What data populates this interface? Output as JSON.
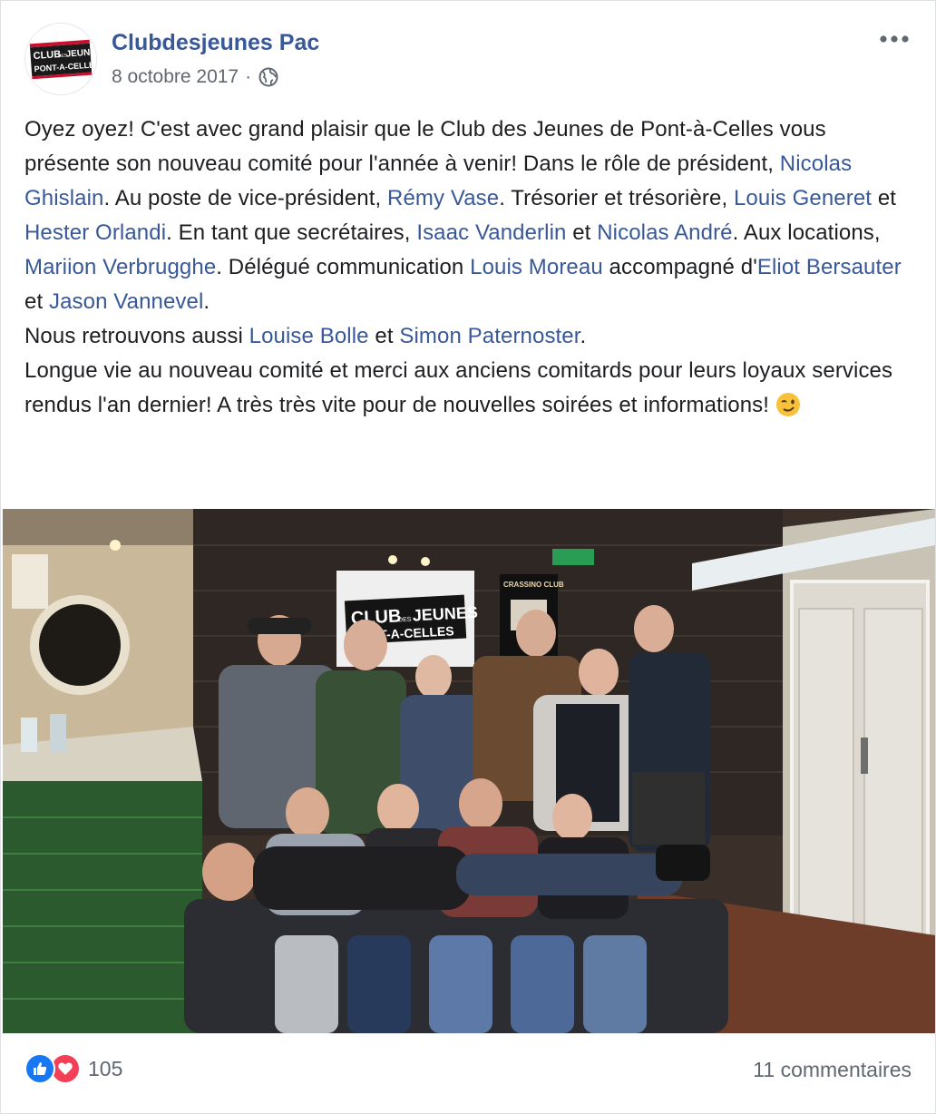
{
  "post": {
    "page_name": "Clubdesjeunes Pac",
    "date": "8 octobre 2017",
    "separator": "·",
    "privacy_icon": "globe-icon",
    "more_icon": "more-options-icon",
    "avatar_logo": {
      "line1": "CLUB",
      "small": "DES",
      "line2": "JEUNES",
      "line3": "PONT-A-CELLES"
    }
  },
  "body": {
    "segments": [
      {
        "t": "Oyez oyez! C'est avec grand plaisir que le Club des Jeunes de Pont-à-Celles vous présente son nouveau comité pour l'année à venir! Dans le rôle de président, "
      },
      {
        "t": "Nicolas Ghislain",
        "link": true
      },
      {
        "t": ". Au poste de vice-président, "
      },
      {
        "t": "Rémy Vase",
        "link": true
      },
      {
        "t": ". Trésorier et trésorière, "
      },
      {
        "t": "Louis Generet",
        "link": true
      },
      {
        "t": " et "
      },
      {
        "t": "Hester Orlandi",
        "link": true
      },
      {
        "t": ". En tant que secrétaires, "
      },
      {
        "t": "Isaac Vanderlin",
        "link": true
      },
      {
        "t": " et "
      },
      {
        "t": "Nicolas André",
        "link": true
      },
      {
        "t": ". Aux locations, "
      },
      {
        "t": "Mariion Verbrugghe",
        "link": true
      },
      {
        "t": ". Délégué communication "
      },
      {
        "t": "Louis Moreau",
        "link": true
      },
      {
        "t": " accompagné d'"
      },
      {
        "t": "Eliot Bersauter",
        "link": true
      },
      {
        "t": " et "
      },
      {
        "t": "Jason Vannevel",
        "link": true
      },
      {
        "t": ".",
        "br": true
      },
      {
        "t": "Nous retrouvons aussi "
      },
      {
        "t": "Louise Bolle",
        "link": true
      },
      {
        "t": " et "
      },
      {
        "t": "Simon Paternoster",
        "link": true
      },
      {
        "t": ".",
        "br": true
      },
      {
        "t": "Longue vie au nouveau comité et merci aux anciens comitards pour leurs loyaux services rendus l'an dernier! A très très vite pour de nouvelles soirées et informations! "
      }
    ],
    "emoji": "winking-face-icon"
  },
  "photo": {
    "banner": {
      "line1": "CLUB",
      "small": "DES",
      "line2": "JEUNES",
      "line3": "PONT-A-CELLES"
    },
    "poster_title": "CRASSINO CLUB"
  },
  "footer": {
    "reaction_icons": [
      "like-icon",
      "love-icon"
    ],
    "reaction_count": "105",
    "comments": "11 commentaires"
  },
  "colors": {
    "link": "#385898",
    "meta": "#616770",
    "like": "#1877f2",
    "love": "#f33e58"
  }
}
